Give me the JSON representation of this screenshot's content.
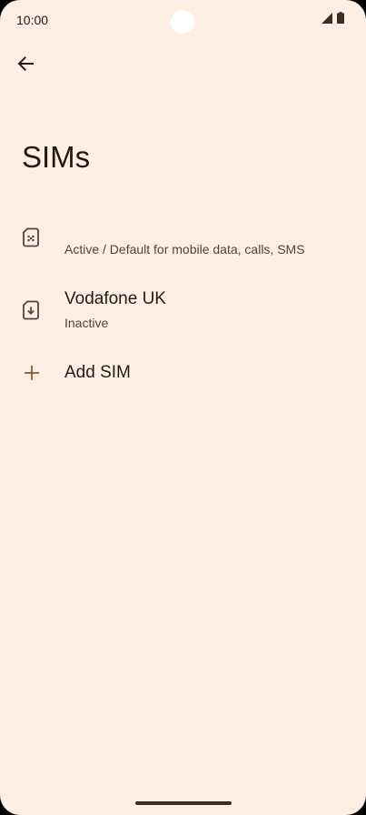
{
  "status_bar": {
    "time": "10:00",
    "icons": [
      "signal-icon",
      "battery-icon"
    ]
  },
  "header": {
    "back_icon": "arrow-back-icon",
    "title": "SIMs"
  },
  "sims": [
    {
      "icon": "sim-card-icon",
      "title": "",
      "summary": "Active / Default for mobile data, calls, SMS"
    },
    {
      "icon": "esim-download-icon",
      "title": "Vodafone UK",
      "summary": "Inactive"
    }
  ],
  "add_sim": {
    "icon": "plus-icon",
    "label": "Add SIM"
  },
  "colors": {
    "background": "#FFEEE4",
    "text_primary": "#231A16",
    "text_secondary": "#52443C",
    "accent": "#8B5A2B"
  }
}
